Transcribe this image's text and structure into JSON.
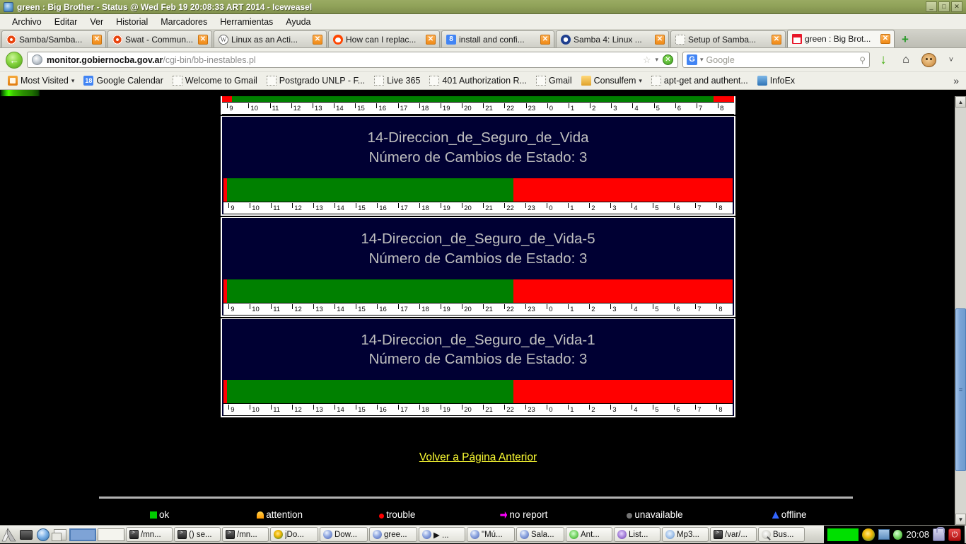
{
  "window": {
    "title": "green : Big Brother - Status @ Wed Feb 19 20:08:33 ART 2014 - Iceweasel",
    "icon": "iceweasel-icon",
    "buttons": {
      "minimize": "_",
      "maximize": "□",
      "close": "✕"
    }
  },
  "menubar": {
    "items": [
      {
        "label": "Archivo"
      },
      {
        "label": "Editar"
      },
      {
        "label": "Ver"
      },
      {
        "label": "Historial"
      },
      {
        "label": "Marcadores"
      },
      {
        "label": "Herramientas"
      },
      {
        "label": "Ayuda"
      }
    ]
  },
  "tabs": {
    "new_tab_label": "+",
    "items": [
      {
        "label": "Samba/Samba...",
        "favicon": "samba-icon",
        "close": "✕",
        "active": false
      },
      {
        "label": "Swat - Commun...",
        "favicon": "samba-icon",
        "close": "✕",
        "active": false
      },
      {
        "label": "Linux as an Acti...",
        "favicon": "wordpress-icon",
        "close": "✕",
        "active": false
      },
      {
        "label": "How can I replac...",
        "favicon": "reddit-icon",
        "close": "✕",
        "active": false
      },
      {
        "label": "install and confi...",
        "favicon": "stackoverflow-icon",
        "close": "✕",
        "active": false
      },
      {
        "label": "Samba 4: Linux ...",
        "favicon": "linux-icon",
        "close": "✕",
        "active": false
      },
      {
        "label": "Setup of Samba...",
        "favicon": "blank-page-icon",
        "close": "✕",
        "active": false
      },
      {
        "label": "green : Big Brot...",
        "favicon": "bigbrother-icon",
        "close": "✕",
        "active": true
      }
    ]
  },
  "navbar": {
    "back_label": "←",
    "url_domain": "monitor.gobiernocba.gov.ar",
    "url_path": "/cgi-bin/bb-inestables.pl",
    "star_icon": "☆",
    "caret_icon": "▾",
    "stop_icon": "✕",
    "search_engine": "G",
    "search_placeholder": "Google",
    "search_magnifier": "🔍",
    "download_icon": "↓",
    "home_icon": "⌂",
    "monkey_icon": "monkey-icon",
    "overflow_icon": "˅"
  },
  "bookmarks": {
    "overflow": "»",
    "items": [
      {
        "label": "Most Visited",
        "icon": "most-visited-icon",
        "caret": "▾"
      },
      {
        "label": "Google Calendar",
        "icon": "google-calendar-icon",
        "caret": ""
      },
      {
        "label": "Welcome to Gmail",
        "icon": "blank-page-icon",
        "caret": ""
      },
      {
        "label": "Postgrado UNLP - F...",
        "icon": "blank-page-icon",
        "caret": ""
      },
      {
        "label": "Live 365",
        "icon": "blank-page-icon",
        "caret": ""
      },
      {
        "label": "401 Authorization R...",
        "icon": "blank-page-icon",
        "caret": ""
      },
      {
        "label": "Gmail",
        "icon": "blank-page-icon",
        "caret": ""
      },
      {
        "label": "Consulfem",
        "icon": "folder-icon",
        "caret": "▾"
      },
      {
        "label": "apt-get and authent...",
        "icon": "blank-page-icon",
        "caret": ""
      },
      {
        "label": "InfoEx",
        "icon": "infoex-icon",
        "caret": ""
      }
    ]
  },
  "page": {
    "back_link": "Volver a Página Anterior",
    "axis_ticks": [
      "9",
      "10",
      "11",
      "12",
      "13",
      "14",
      "15",
      "16",
      "17",
      "18",
      "19",
      "20",
      "21",
      "22",
      "23",
      "0",
      "1",
      "2",
      "3",
      "4",
      "5",
      "6",
      "7",
      "8"
    ],
    "colors": {
      "ok": "#008000",
      "trouble": "#ff0000",
      "panel_bg": "#000033",
      "border": "#ffffff",
      "text": "#bfbfbf",
      "link": "#ffff33",
      "page_bg": "#000000"
    },
    "partial_top_bar": {
      "segments": [
        {
          "color": "#ff0000",
          "pct": 2.0
        },
        {
          "color": "#008000",
          "pct": 94.0
        },
        {
          "color": "#ff0000",
          "pct": 4.0
        }
      ]
    },
    "panels": [
      {
        "name": "14-Direccion_de_Seguro_de_Vida",
        "changes_label": "Número de Cambios de Estado: 3",
        "changes": 3,
        "segments": [
          {
            "color": "#ff0000",
            "pct": 0.7
          },
          {
            "color": "#008000",
            "pct": 56.2
          },
          {
            "color": "#ff0000",
            "pct": 43.1
          }
        ]
      },
      {
        "name": "14-Direccion_de_Seguro_de_Vida-5",
        "changes_label": "Número de Cambios de Estado: 3",
        "changes": 3,
        "segments": [
          {
            "color": "#ff0000",
            "pct": 0.7
          },
          {
            "color": "#008000",
            "pct": 56.2
          },
          {
            "color": "#ff0000",
            "pct": 43.1
          }
        ]
      },
      {
        "name": "14-Direccion_de_Seguro_de_Vida-1",
        "changes_label": "Número de Cambios de Estado: 3",
        "changes": 3,
        "segments": [
          {
            "color": "#ff0000",
            "pct": 0.7
          },
          {
            "color": "#008000",
            "pct": 56.2
          },
          {
            "color": "#ff0000",
            "pct": 43.1
          }
        ]
      }
    ],
    "legend": [
      {
        "label": "ok",
        "icon": "ok-square-icon",
        "color": "#00cc00"
      },
      {
        "label": "attention",
        "icon": "attention-icon",
        "color": "#ff9900"
      },
      {
        "label": "trouble",
        "icon": "trouble-icon",
        "color": "#ff0000"
      },
      {
        "label": "no report",
        "icon": "no-report-icon",
        "color": "#ff00ff"
      },
      {
        "label": "unavailable",
        "icon": "unavailable-icon",
        "color": "#9a9a9a"
      },
      {
        "label": "offline",
        "icon": "offline-icon",
        "color": "#3366ff"
      }
    ]
  },
  "scrollbar": {
    "up": "▲",
    "down": "▼",
    "grip": "≡"
  },
  "taskbar": {
    "launchers": [
      {
        "name": "menu-icon"
      },
      {
        "name": "terminal-icon"
      },
      {
        "name": "browser-icon"
      },
      {
        "name": "show-desktop-icon"
      }
    ],
    "tasks": [
      {
        "label": "/mn...",
        "icon": "terminal-icon"
      },
      {
        "label": "() se...",
        "icon": "terminal-icon"
      },
      {
        "label": "/mn...",
        "icon": "terminal-icon"
      },
      {
        "label": "jDo...",
        "icon": "jdownloader-icon"
      },
      {
        "label": "Dow...",
        "icon": "iceweasel-icon"
      },
      {
        "label": "gree...",
        "icon": "iceweasel-icon"
      },
      {
        "label": "▶ ...",
        "icon": "iceweasel-icon"
      },
      {
        "label": "\"Mú...",
        "icon": "iceweasel-icon"
      },
      {
        "label": "Sala...",
        "icon": "iceweasel-icon"
      },
      {
        "label": "Ant...",
        "icon": "green-app-icon"
      },
      {
        "label": "List...",
        "icon": "purple-app-icon"
      },
      {
        "label": "Mp3...",
        "icon": "mp3-icon"
      },
      {
        "label": "/var/...",
        "icon": "terminal-icon"
      },
      {
        "label": "Bus...",
        "icon": "search-icon"
      }
    ],
    "tray": {
      "clock": "20:08",
      "items": [
        "net-monitor-applet",
        "jdownloader-tray-icon",
        "network-icon",
        "drop-icon",
        "lock-icon",
        "power-icon"
      ],
      "power_icon": "⏻"
    }
  }
}
